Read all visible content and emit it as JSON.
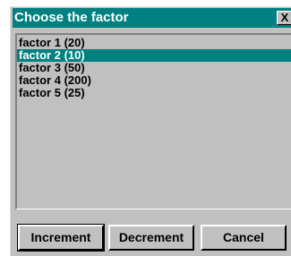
{
  "dialog": {
    "title": "Choose the factor",
    "close_label": "X"
  },
  "list": {
    "selected_index": 1,
    "items": [
      {
        "label": "factor 1 (20)"
      },
      {
        "label": "factor 2 (10)"
      },
      {
        "label": "factor 3 (50)"
      },
      {
        "label": "factor 4 (200)"
      },
      {
        "label": "factor 5 (25)"
      }
    ]
  },
  "buttons": {
    "increment_label": "Increment",
    "decrement_label": "Decrement",
    "cancel_label": "Cancel"
  },
  "colors": {
    "title_bar": "#008080",
    "selection": "#008080",
    "face": "#c0c0c0"
  }
}
